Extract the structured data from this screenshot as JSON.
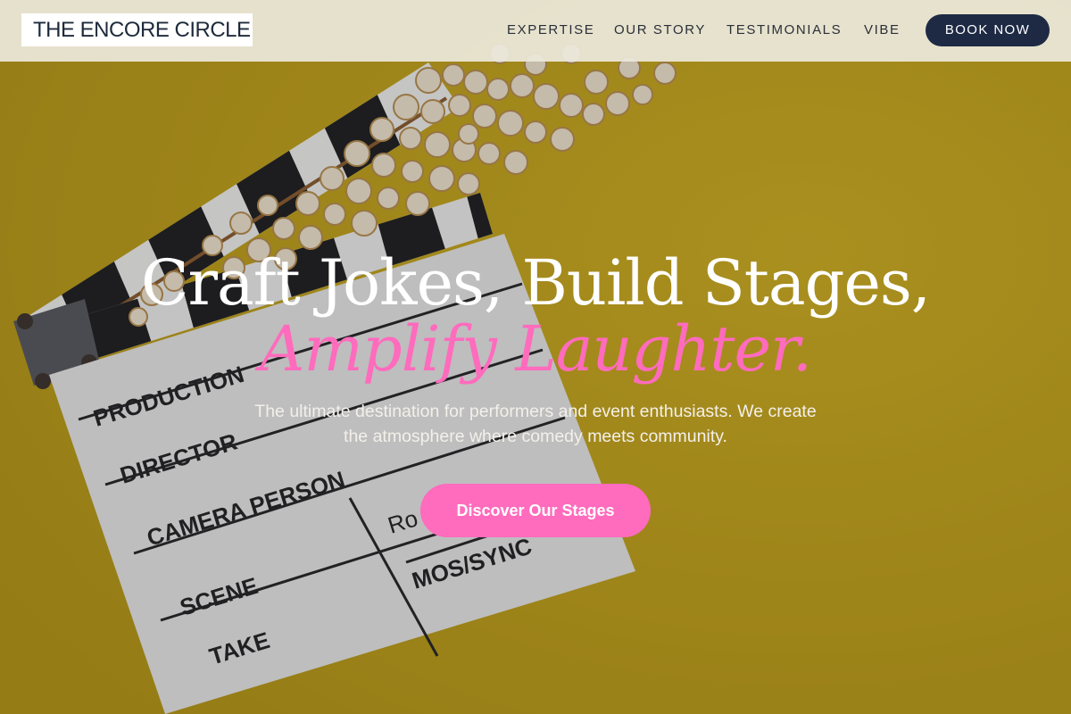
{
  "brand": {
    "logo_text": "THE ENCORE CIRCLE"
  },
  "nav": {
    "links": [
      "EXPERTISE",
      "OUR STORY",
      "TESTIMONIALS",
      "VIBE"
    ],
    "cta_label": "BOOK NOW"
  },
  "hero": {
    "title_line1": "Craft Jokes, Build Stages,",
    "title_line2": "Amplify Laughter.",
    "subtitle": "The ultimate destination for performers and event enthusiasts. We create the atmosphere where comedy meets community.",
    "cta_label": "Discover Our Stages",
    "background": {
      "description_icon": "clapperboard-popcorn-photo",
      "clapper_labels": [
        "PRODUCTION",
        "DIRECTOR",
        "CAMERA PERSON",
        "SCENE",
        "TAKE",
        "Ro",
        "MOS/SYNC"
      ]
    }
  },
  "colors": {
    "background_yellow": "#c9a617",
    "accent_pink": "#ff6bbd",
    "navy": "#1e2a44",
    "nav_bg": "#ece8da"
  }
}
